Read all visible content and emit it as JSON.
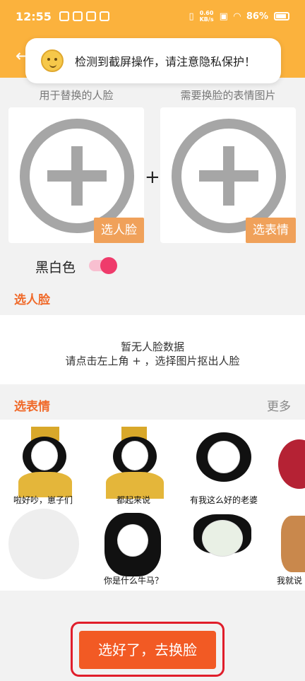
{
  "status_bar": {
    "time": "12:55",
    "speed_value": "0.60",
    "speed_unit": "KB/s",
    "battery": "86%"
  },
  "toast": {
    "message": "检测到截屏操作，请注意隐私保护！",
    "icon": "emoji-icon"
  },
  "picker": {
    "left_label": "用于替换的人脸",
    "right_label": "需要换脸的表情图片",
    "left_button": "选人脸",
    "right_button": "选表情",
    "join_symbol": "+"
  },
  "options": {
    "bw_label": "黑白色",
    "bw_enabled": true,
    "accent": "#ef3b6b"
  },
  "face_section": {
    "title": "选人脸",
    "empty_line1": "暂无人脸数据",
    "empty_line2": "请点击左上角 + ，选择图片抠出人脸"
  },
  "expression_section": {
    "title": "选表情",
    "more": "更多",
    "stickers": [
      {
        "caption": "啦好吵，崽子们"
      },
      {
        "caption": "都起来说"
      },
      {
        "caption": "有我这么好的老婆"
      },
      {
        "caption": ""
      },
      {
        "caption": ""
      },
      {
        "caption": "你是什么牛马？"
      },
      {
        "caption": ""
      },
      {
        "caption": "我就说"
      }
    ]
  },
  "action": {
    "go_button": "选好了，去换脸",
    "brand_color": "#f25a24",
    "highlight_color": "#e01e2b"
  }
}
